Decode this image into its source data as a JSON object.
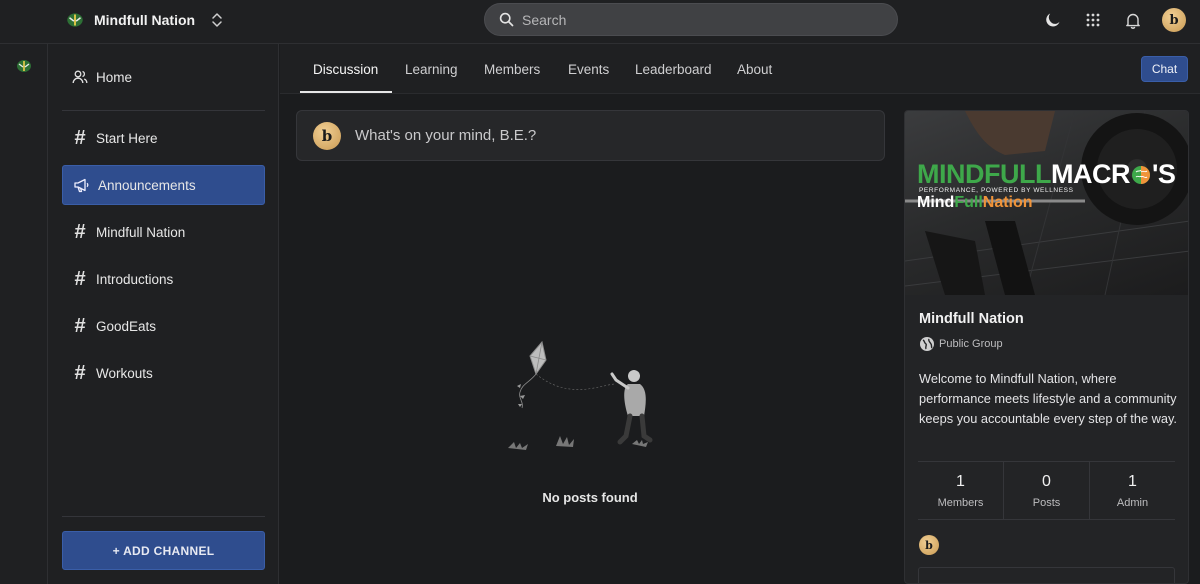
{
  "topbar": {
    "group_name": "Mindfull Nation",
    "search_placeholder": "Search",
    "avatar_letter": "b"
  },
  "sidebar": {
    "items": [
      {
        "label": "Home",
        "icon": "people-icon"
      },
      {
        "label": "Start Here",
        "icon": "hash-icon"
      },
      {
        "label": "Announcements",
        "icon": "megaphone-icon",
        "active": true
      },
      {
        "label": "Mindfull Nation",
        "icon": "hash-icon"
      },
      {
        "label": "Introductions",
        "icon": "hash-icon"
      },
      {
        "label": "GoodEats",
        "icon": "hash-icon"
      },
      {
        "label": "Workouts",
        "icon": "hash-icon"
      }
    ],
    "add_channel_label": "+ ADD CHANNEL"
  },
  "tabs": {
    "items": [
      "Discussion",
      "Learning",
      "Members",
      "Events",
      "Leaderboard",
      "About"
    ],
    "active": "Discussion",
    "chat_label": "Chat"
  },
  "feed": {
    "composer_placeholder": "What's on your mind, B.E.?",
    "empty_text": "No posts found"
  },
  "group_card": {
    "banner": {
      "brand_green": "MINDFULL",
      "brand_white": "MACR",
      "brand_tail": "'S",
      "tagline": "PERFORMANCE, POWERED BY WELLNESS",
      "sub_white": "Mind",
      "sub_green": "Full",
      "sub_orange": "Nation"
    },
    "title": "Mindfull Nation",
    "type": "Public Group",
    "description": "Welcome to Mindfull Nation, where performance meets lifestyle and a community keeps you accountable every step of the way.",
    "stats": [
      {
        "value": "1",
        "label": "Members"
      },
      {
        "value": "0",
        "label": "Posts"
      },
      {
        "value": "1",
        "label": "Admin"
      }
    ]
  },
  "colors": {
    "accent": "#2f4d8e",
    "brand_green": "#3ea84a",
    "brand_orange": "#f0943a",
    "background": "#1b1c1e"
  }
}
